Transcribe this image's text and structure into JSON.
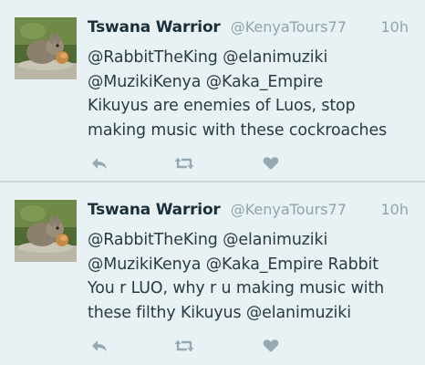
{
  "tweets": [
    {
      "name": "Tswana Warrior",
      "handle": "@KenyaTours77",
      "time": "10h",
      "lines": [
        "@RabbitTheKing @elanimuziki",
        "@MuzikiKenya @Kaka_Empire",
        "Kikuyus are enemies of Luos, stop",
        "making music with these cockroaches"
      ],
      "icons": [
        "reply-icon",
        "retweet-icon",
        "like-icon"
      ]
    },
    {
      "name": "Tswana Warrior",
      "handle": "@KenyaTours77",
      "time": "10h",
      "lines": [
        "@RabbitTheKing @elanimuziki",
        "@MuzikiKenya @Kaka_Empire  Rabbit",
        "You r LUO, why r u making music with",
        "these filthy Kikuyus @elanimuziki"
      ],
      "icons": [
        "reply-icon",
        "retweet-icon",
        "like-icon"
      ]
    }
  ],
  "colors": {
    "background": "#e8f2f4",
    "name": "#1b2f3a",
    "muted": "#8fa3ad",
    "body": "#2a3a44",
    "icon": "#97a9b2"
  }
}
